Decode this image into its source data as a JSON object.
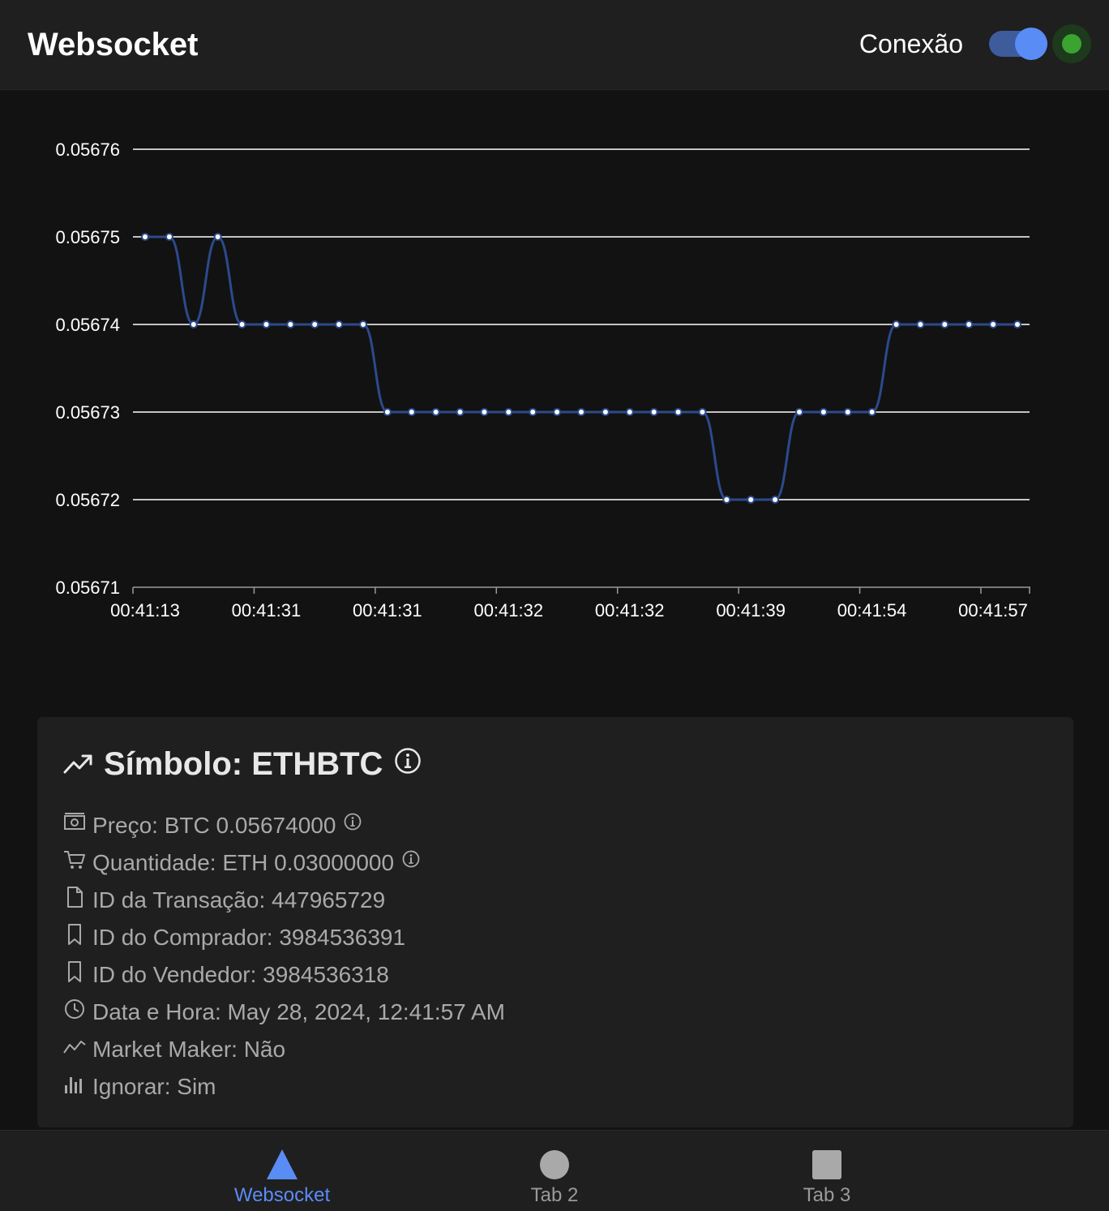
{
  "header": {
    "title": "Websocket",
    "connection_label": "Conexão",
    "connection_on": true,
    "status_color": "#3ba32f",
    "accent_color": "#5a8cf5"
  },
  "chart_data": {
    "type": "line",
    "title": "",
    "xlabel": "",
    "ylabel": "",
    "ylim": [
      0.05671,
      0.05676
    ],
    "y_ticks": [
      "0.05676",
      "0.05675",
      "0.05674",
      "0.05673",
      "0.05672",
      "0.05671"
    ],
    "x_ticks": [
      "00:41:13",
      "00:41:31",
      "00:41:31",
      "00:41:32",
      "00:41:32",
      "00:41:39",
      "00:41:54",
      "00:41:57"
    ],
    "grid": true,
    "series": [
      {
        "color": "#2c4a8c",
        "values": [
          0.05675,
          0.05675,
          0.05674,
          0.05675,
          0.05674,
          0.05674,
          0.05674,
          0.05674,
          0.05674,
          0.05674,
          0.05673,
          0.05673,
          0.05673,
          0.05673,
          0.05673,
          0.05673,
          0.05673,
          0.05673,
          0.05673,
          0.05673,
          0.05673,
          0.05673,
          0.05673,
          0.05673,
          0.05672,
          0.05672,
          0.05672,
          0.05673,
          0.05673,
          0.05673,
          0.05673,
          0.05674,
          0.05674,
          0.05674,
          0.05674,
          0.05674,
          0.05674
        ]
      }
    ]
  },
  "details": {
    "title": "Símbolo: ETHBTC",
    "rows": [
      {
        "icon": "money-icon",
        "text": "Preço: BTC 0.05674000",
        "info": true
      },
      {
        "icon": "cart-icon",
        "text": "Quantidade: ETH 0.03000000",
        "info": true
      },
      {
        "icon": "document-icon",
        "text": "ID da Transação: 447965729",
        "info": false
      },
      {
        "icon": "bookmark-icon",
        "text": "ID do Comprador: 3984536391",
        "info": false
      },
      {
        "icon": "bookmark-icon",
        "text": "ID do Vendedor: 3984536318",
        "info": false
      },
      {
        "icon": "clock-icon",
        "text": "Data e Hora: May 28, 2024, 12:41:57 AM",
        "info": false
      },
      {
        "icon": "trend-icon",
        "text": "Market Maker: Não",
        "info": false
      },
      {
        "icon": "bar-chart-icon",
        "text": "Ignorar: Sim",
        "info": false
      }
    ]
  },
  "tabs": [
    {
      "label": "Websocket",
      "icon": "triangle-icon",
      "active": true
    },
    {
      "label": "Tab 2",
      "icon": "circle-icon",
      "active": false
    },
    {
      "label": "Tab 3",
      "icon": "square-icon",
      "active": false
    }
  ]
}
